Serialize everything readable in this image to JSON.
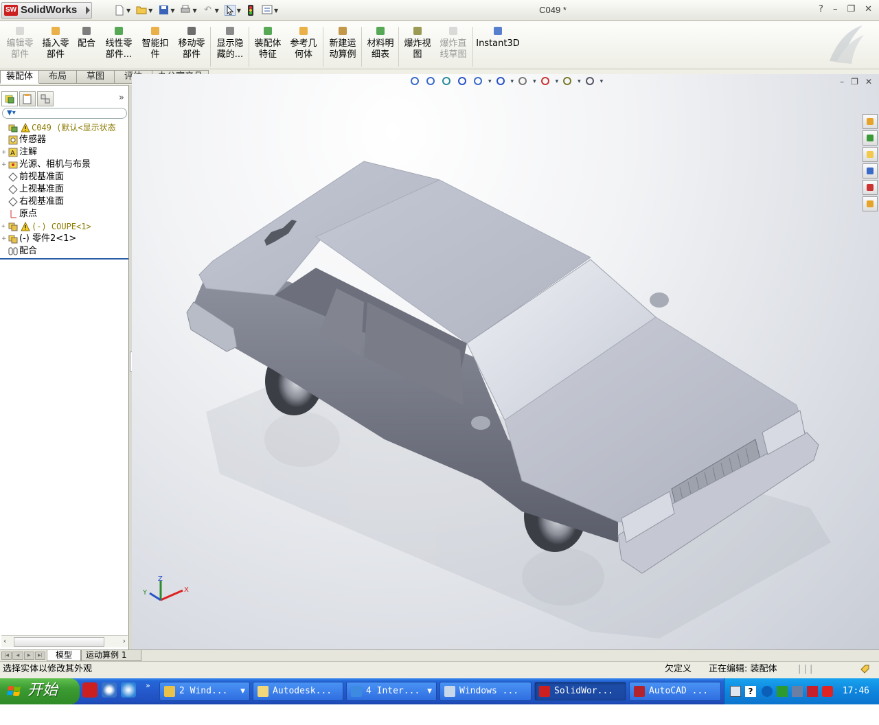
{
  "app": {
    "brand": "SolidWorks",
    "document_title": "C049 *",
    "window_controls": [
      "?",
      "–",
      "❐",
      "✕"
    ]
  },
  "command_manager": {
    "buttons": [
      {
        "label1": "编辑零",
        "label2": "部件",
        "enabled": false,
        "icon": "edit-component-icon"
      },
      {
        "label1": "插入零",
        "label2": "部件",
        "enabled": true,
        "icon": "insert-component-icon"
      },
      {
        "label1": "配合",
        "label2": "",
        "enabled": true,
        "icon": "mate-icon"
      },
      {
        "label1": "线性零",
        "label2": "部件...",
        "enabled": true,
        "icon": "linear-pattern-icon"
      },
      {
        "label1": "智能扣",
        "label2": "件",
        "enabled": true,
        "icon": "smart-fasteners-icon"
      },
      {
        "label1": "移动零",
        "label2": "部件",
        "enabled": true,
        "icon": "move-component-icon"
      },
      {
        "label1": "显示隐",
        "label2": "藏的...",
        "enabled": true,
        "icon": "show-hidden-icon"
      },
      {
        "label1": "装配体",
        "label2": "特征",
        "enabled": true,
        "icon": "assembly-features-icon"
      },
      {
        "label1": "参考几",
        "label2": "何体",
        "enabled": true,
        "icon": "reference-geometry-icon"
      },
      {
        "label1": "新建运",
        "label2": "动算例",
        "enabled": true,
        "icon": "new-motion-study-icon"
      },
      {
        "label1": "材料明",
        "label2": "细表",
        "enabled": true,
        "icon": "bill-of-materials-icon"
      },
      {
        "label1": "爆炸视",
        "label2": "图",
        "enabled": true,
        "icon": "exploded-view-icon"
      },
      {
        "label1": "爆炸直",
        "label2": "线草图",
        "enabled": false,
        "icon": "explode-line-sketch-icon"
      },
      {
        "label1": "Instant3D",
        "label2": "",
        "enabled": true,
        "icon": "instant3d-icon"
      }
    ]
  },
  "tabs": [
    "装配体",
    "布局",
    "草图",
    "评估",
    "办公室产品"
  ],
  "feature_tree": {
    "more": "»",
    "items": [
      {
        "text": "C049  (默认<显示状态",
        "icon": "assembly-icon",
        "warn": true,
        "expand": ""
      },
      {
        "text": "传感器",
        "icon": "sensor-icon",
        "warn": false,
        "expand": ""
      },
      {
        "text": "注解",
        "icon": "annotation-icon",
        "warn": false,
        "expand": "+"
      },
      {
        "text": "光源、相机与布景",
        "icon": "lights-cameras-icon",
        "warn": false,
        "expand": "+"
      },
      {
        "text": "前视基准面",
        "icon": "plane-icon",
        "warn": false,
        "expand": ""
      },
      {
        "text": "上视基准面",
        "icon": "plane-icon",
        "warn": false,
        "expand": ""
      },
      {
        "text": "右视基准面",
        "icon": "plane-icon",
        "warn": false,
        "expand": ""
      },
      {
        "text": "原点",
        "icon": "origin-icon",
        "warn": false,
        "expand": ""
      },
      {
        "text": "(-) COUPE<1>",
        "icon": "part-icon",
        "warn": true,
        "expand": "+"
      },
      {
        "text": "(-)  零件2<1>",
        "icon": "part-icon",
        "warn": false,
        "expand": "+"
      },
      {
        "text": "配合",
        "icon": "mates-folder-icon",
        "warn": false,
        "expand": ""
      }
    ]
  },
  "viewport": {
    "heads_up_icons": [
      "zoom-to-fit-icon",
      "zoom-area-icon",
      "previous-view-icon",
      "section-view-icon",
      "view-orientation-icon",
      "display-style-icon",
      "hide-show-items-icon",
      "edit-appearance-icon",
      "apply-scene-icon",
      "view-settings-icon"
    ],
    "task_pane_icons": [
      "home-icon",
      "design-library-icon",
      "file-explorer-icon",
      "view-palette-icon",
      "appearances-icon",
      "custom-properties-icon"
    ],
    "triad": {
      "x": "X",
      "y": "Y",
      "z": "Z"
    }
  },
  "bottom_tabs": {
    "model": "模型",
    "motion": "运动算例 1"
  },
  "status_bar": {
    "message": "选择实体以修改其外观",
    "definition": "欠定义",
    "editing": "正在编辑: 装配体",
    "grip": "| | |"
  },
  "taskbar": {
    "start_label": "开始",
    "quick_more": "»",
    "buttons": [
      {
        "label": "2 Wind...",
        "dropdown": true,
        "active": false,
        "color": "#e8c24a"
      },
      {
        "label": "Autodesk...",
        "dropdown": false,
        "active": false,
        "color": "#f1d77a"
      },
      {
        "label": "4 Inter...",
        "dropdown": true,
        "active": false,
        "color": "#3d8be0"
      },
      {
        "label": "Windows ...",
        "dropdown": false,
        "active": false,
        "color": "#c9d7ea"
      },
      {
        "label": "SolidWor...",
        "dropdown": false,
        "active": true,
        "color": "#cc1f1f"
      },
      {
        "label": "AutoCAD ...",
        "dropdown": false,
        "active": false,
        "color": "#b3232d"
      }
    ],
    "clock": "17:46"
  }
}
